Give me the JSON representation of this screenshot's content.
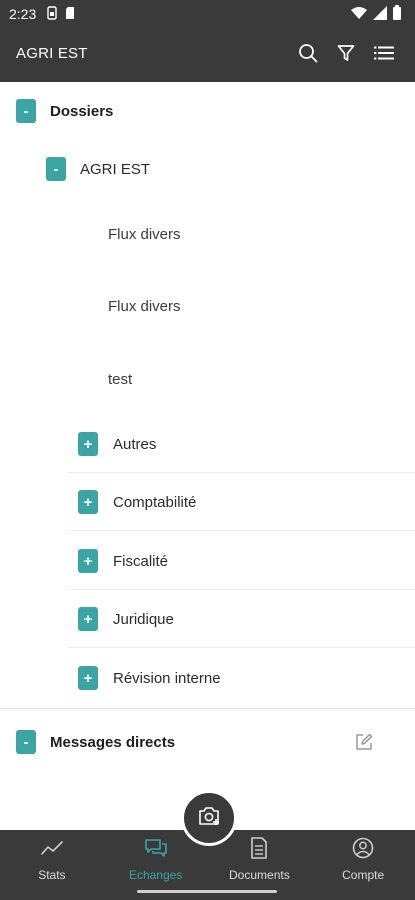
{
  "status_bar": {
    "time": "2:23",
    "icons_left": [
      "sim-icon",
      "sd-card-icon"
    ],
    "icons_right": [
      "wifi-icon",
      "signal-icon",
      "battery-icon"
    ]
  },
  "app_bar": {
    "title": "AGRI EST",
    "actions": [
      "search-icon",
      "filter-icon",
      "list-icon"
    ]
  },
  "tree": {
    "root_toggle": "-",
    "root_label": "Dossiers",
    "group_toggle": "-",
    "group_label": "AGRI EST",
    "files": [
      "Flux divers",
      "Flux divers",
      "test"
    ],
    "folders": [
      {
        "toggle": "+",
        "label": "Autres"
      },
      {
        "toggle": "+",
        "label": "Comptabilité"
      },
      {
        "toggle": "+",
        "label": "Fiscalité"
      },
      {
        "toggle": "+",
        "label": "Juridique"
      },
      {
        "toggle": "+",
        "label": "Révision interne"
      }
    ]
  },
  "messages": {
    "toggle": "-",
    "label": "Messages directs",
    "action_icon": "edit-icon"
  },
  "fab": {
    "icon": "camera-add-icon"
  },
  "bottom_nav": {
    "active": "Echanges",
    "items": [
      {
        "label": "Stats",
        "icon": "chart-icon"
      },
      {
        "label": "Echanges",
        "icon": "chat-icon"
      },
      {
        "label": "Documents",
        "icon": "document-icon"
      },
      {
        "label": "Compte",
        "icon": "account-icon"
      }
    ]
  },
  "colors": {
    "bar_bg": "#3a3a3a",
    "accent": "#3ba5a6",
    "text": "#2b2b2b"
  }
}
